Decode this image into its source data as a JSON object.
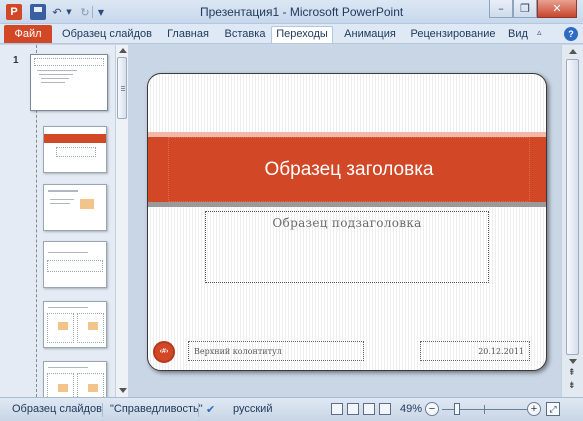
{
  "window": {
    "title": "Презентация1  -  Microsoft PowerPoint",
    "app_icon_letter": "P",
    "minimize": "–",
    "restore": "❐",
    "close": "✕"
  },
  "ribbon": {
    "file_tab": "Файл",
    "tabs": [
      "Образец слайдов",
      "Главная",
      "Вставка",
      "Переходы",
      "Анимация",
      "Рецензирование",
      "Вид"
    ],
    "active_tab": "Переходы",
    "help": "?"
  },
  "thumbnails": {
    "master_number": "1",
    "selected_index": 1
  },
  "slide": {
    "title": "Образец заголовка",
    "subtitle": "Образец подзаголовка",
    "footer": "Верхний колонтитул",
    "date": "20.12.2011",
    "number_badge": "‹#›"
  },
  "statusbar": {
    "view": "Образец слайдов",
    "theme": "\"Справедливость\"",
    "language": "русский",
    "zoom": "49%",
    "zoom_percent": 49
  },
  "colors": {
    "accent": "#d24726",
    "ribbon_bg": "#dfe9f5"
  }
}
